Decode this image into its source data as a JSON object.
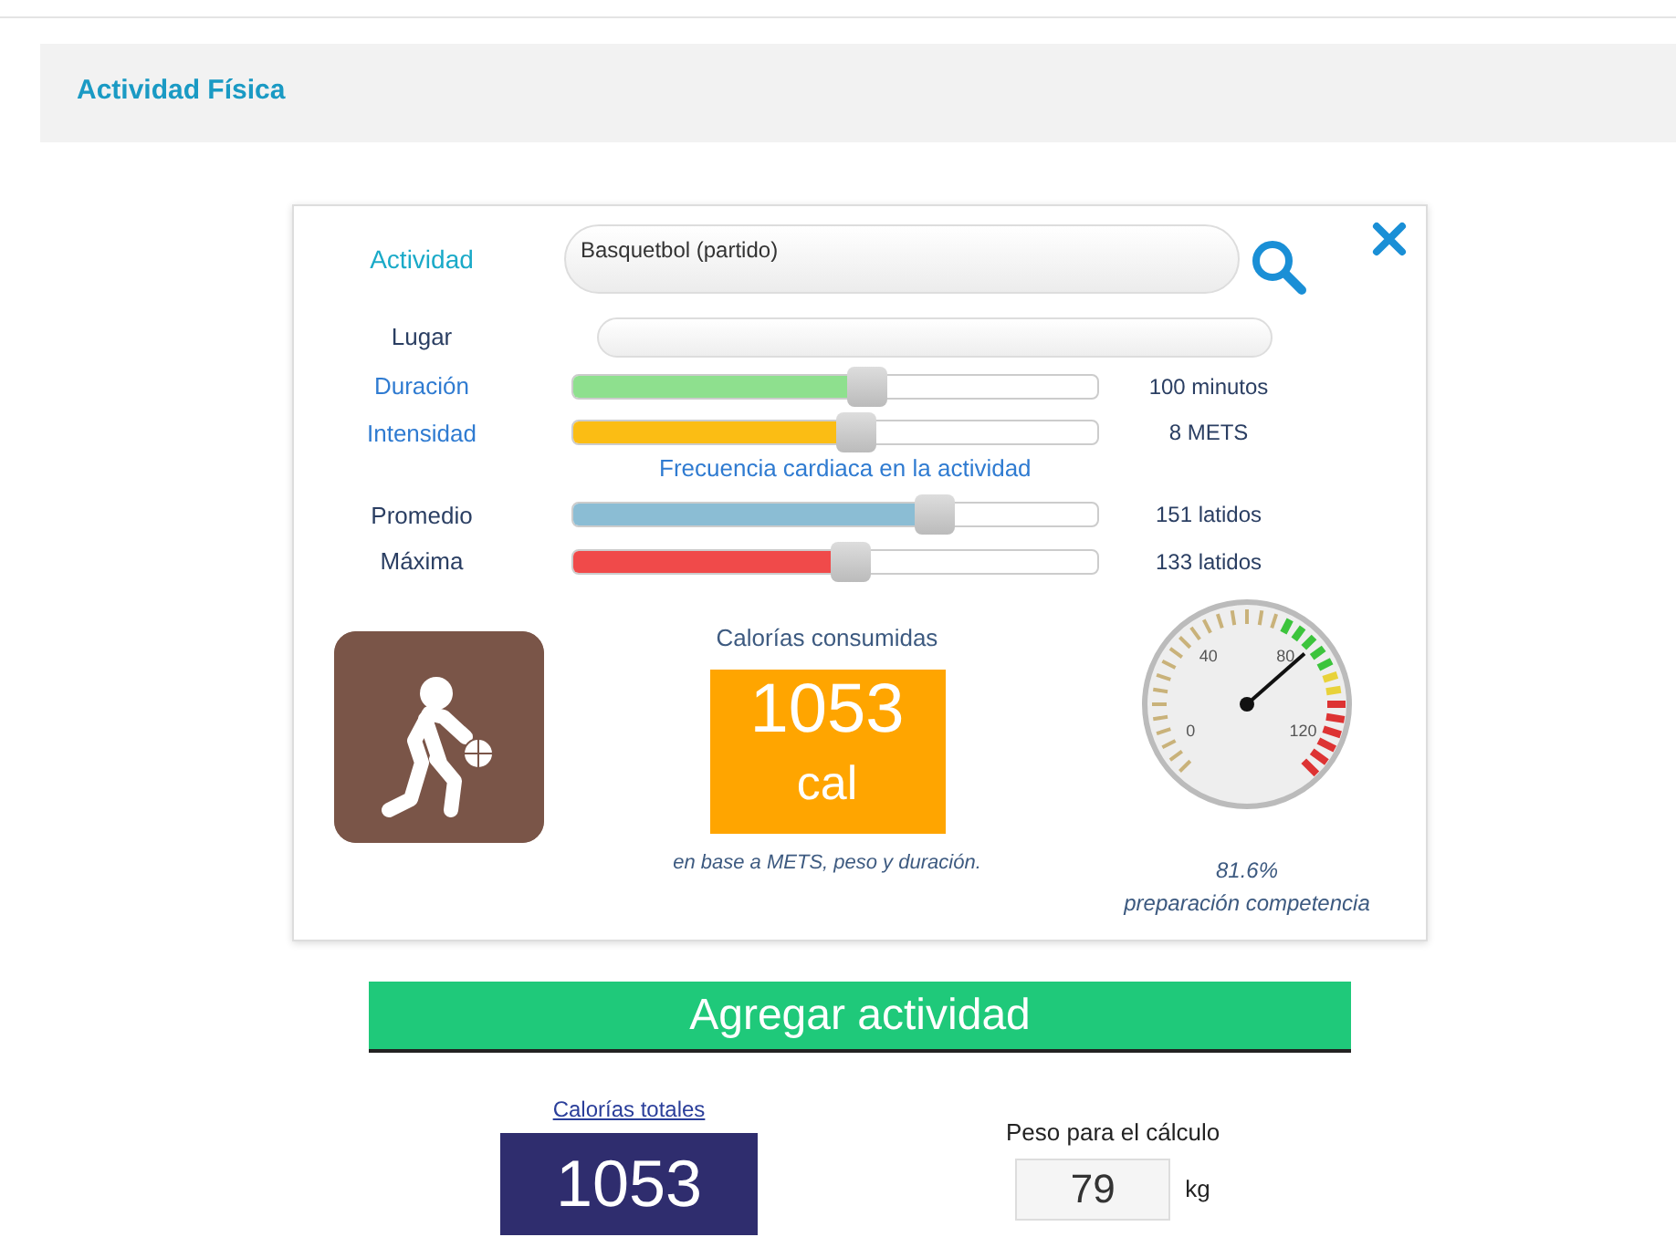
{
  "header": {
    "title": "Actividad Física"
  },
  "activity": {
    "label": "Actividad",
    "value": "Basquetbol (partido)"
  },
  "place": {
    "label": "Lugar"
  },
  "sliders": [
    {
      "label": "Duración",
      "level": 0.56,
      "color": "#8ee08e",
      "reading": "100 minutos"
    },
    {
      "label": "Intensidad",
      "level": 0.54,
      "color": "#fbbd14",
      "reading": "8 METS"
    }
  ],
  "heart_rate": {
    "title": "Frecuencia cardiaca en la actividad",
    "sliders": [
      {
        "label": "Promedio",
        "level": 0.69,
        "color": "#8bbdd4",
        "reading": "151 latidos"
      },
      {
        "label": "Máxima",
        "level": 0.53,
        "color": "#f04a4a",
        "reading": "133 latidos"
      }
    ]
  },
  "calories": {
    "title": "Calorías consumidas",
    "value": "1053",
    "unit": "cal",
    "note": "en base a METS, peso y duración."
  },
  "gauge": {
    "ticks": [
      "0",
      "40",
      "80",
      "120"
    ],
    "level": 0.68,
    "percent": "81.6%",
    "caption": "preparación competencia"
  },
  "add_button": "Agregar actividad",
  "totals": {
    "label": "Calorías totales",
    "value": "1053"
  },
  "weight": {
    "label": "Peso para el cálculo",
    "value": "79",
    "unit": "kg"
  }
}
